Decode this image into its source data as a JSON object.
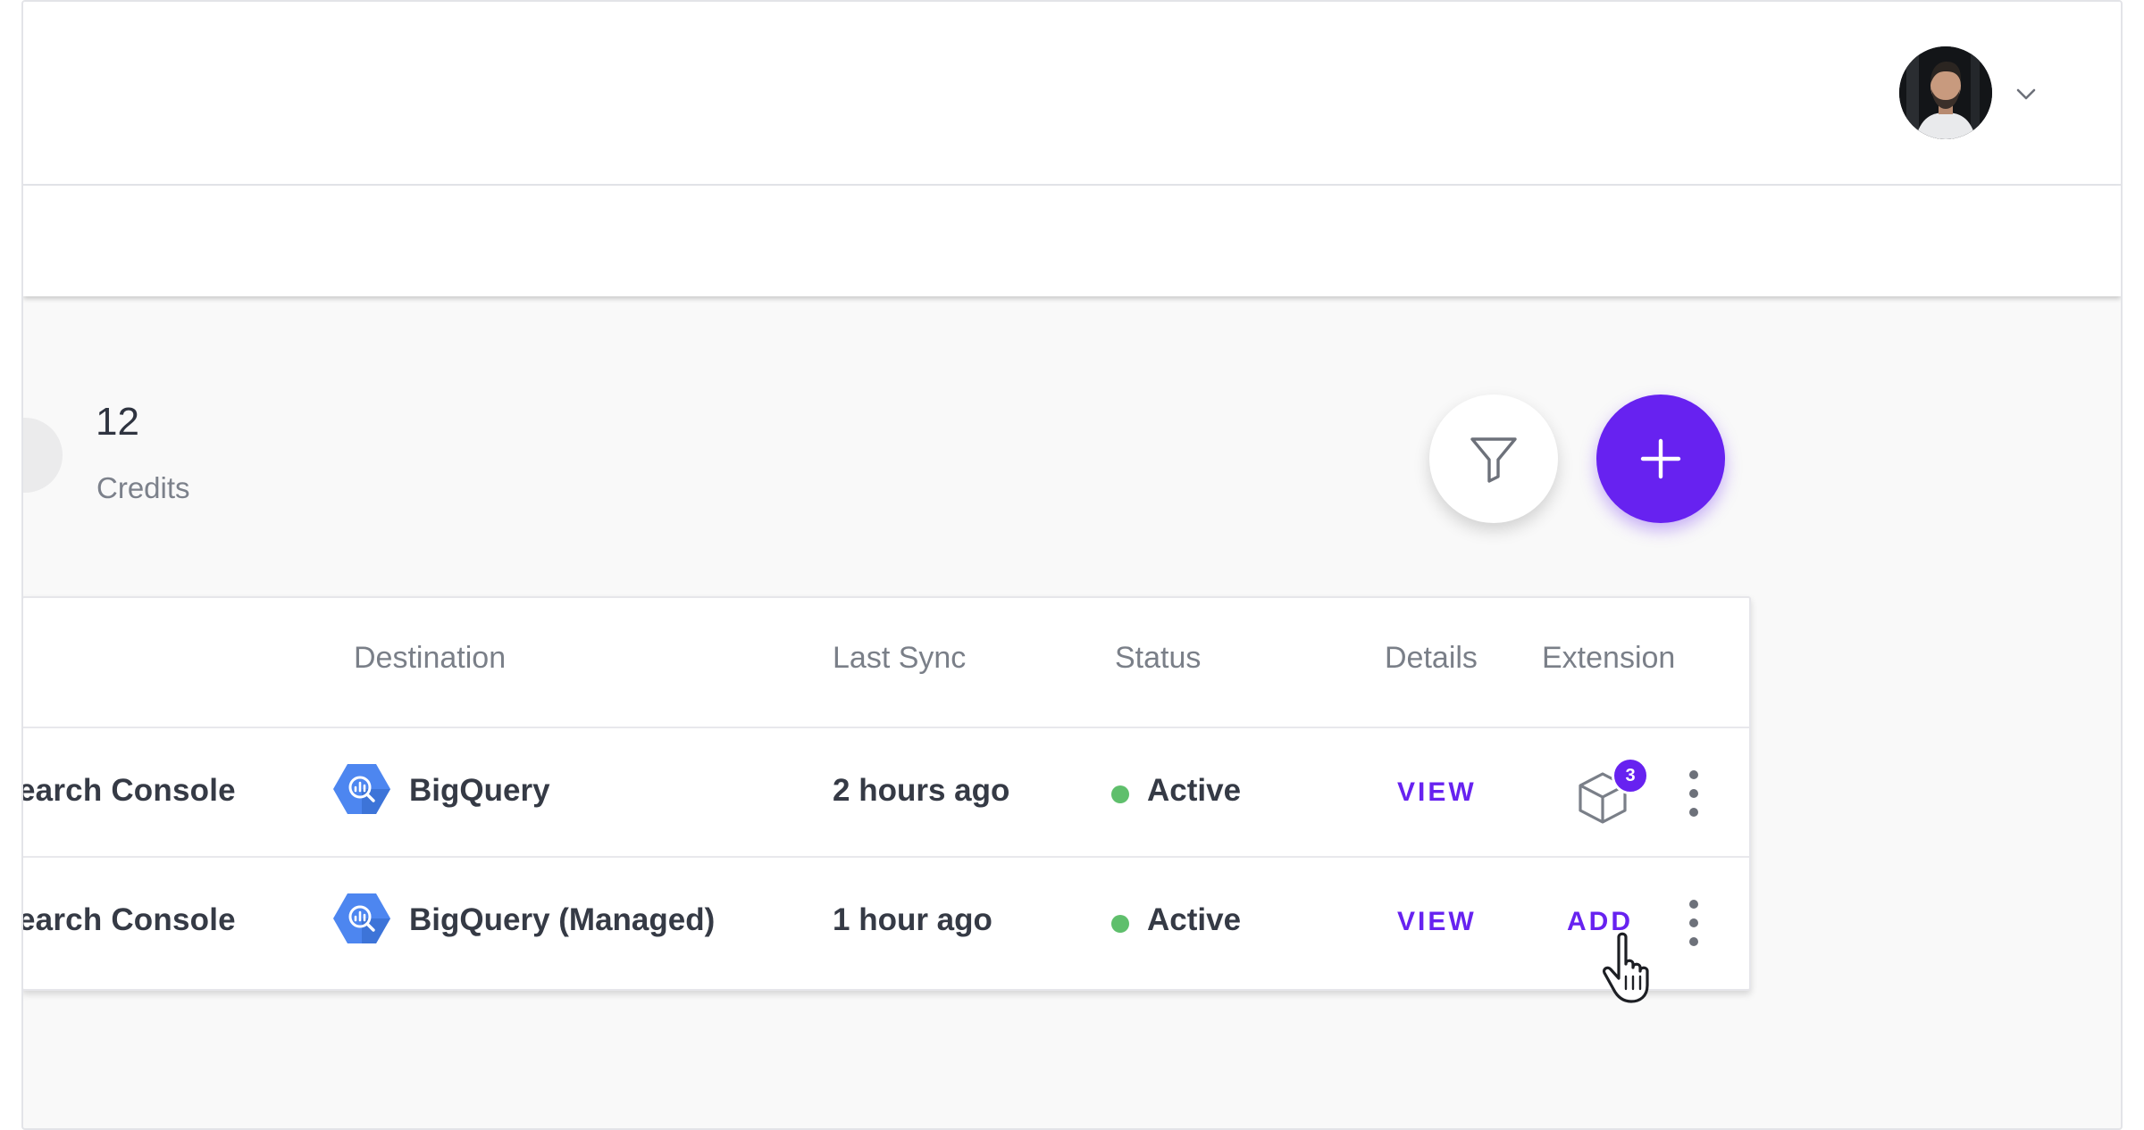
{
  "header": {
    "avatar_icon": "user-avatar",
    "menu_icon": "chevron-down-icon"
  },
  "summary": {
    "credits_value": "12",
    "credits_label": "Credits"
  },
  "actions": {
    "filter_icon": "filter-icon",
    "add_icon": "plus-icon"
  },
  "table": {
    "columns": {
      "destination": "Destination",
      "last_sync": "Last Sync",
      "status": "Status",
      "details": "Details",
      "extension": "Extension"
    },
    "rows": [
      {
        "source": "earch Console",
        "destination": "BigQuery",
        "destination_icon": "bigquery-icon",
        "last_sync": "2 hours ago",
        "status": "Active",
        "details": "VIEW",
        "extension_icon": "package-icon",
        "extension_badge": "3",
        "more_icon": "kebab-menu-icon"
      },
      {
        "source": "earch Console",
        "destination": "BigQuery (Managed)",
        "destination_icon": "bigquery-icon",
        "last_sync": "1 hour ago",
        "status": "Active",
        "details": "VIEW",
        "extension_action": "ADD",
        "more_icon": "kebab-menu-icon"
      }
    ]
  },
  "colors": {
    "accent": "#6722f0",
    "status_active": "#5fbf6c",
    "bigquery_blue": "#4d86f0",
    "page_background": "#f9f9f9"
  }
}
